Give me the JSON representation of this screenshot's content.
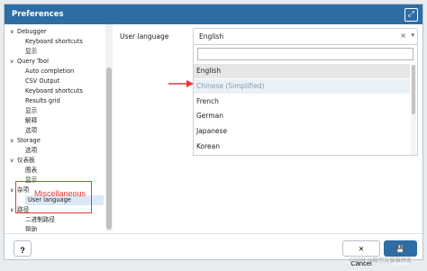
{
  "window": {
    "title": "Preferences"
  },
  "tree": [
    {
      "label": "Debugger",
      "kind": "node",
      "chev": "∨"
    },
    {
      "label": "Keyboard shortcuts",
      "kind": "leaf"
    },
    {
      "label": "显示",
      "kind": "leaf"
    },
    {
      "label": "Query Tool",
      "kind": "node",
      "chev": "∨"
    },
    {
      "label": "Auto completion",
      "kind": "leaf"
    },
    {
      "label": "CSV Output",
      "kind": "leaf"
    },
    {
      "label": "Keyboard shortcuts",
      "kind": "leaf"
    },
    {
      "label": "Results grid",
      "kind": "leaf"
    },
    {
      "label": "显示",
      "kind": "leaf"
    },
    {
      "label": "解释",
      "kind": "leaf"
    },
    {
      "label": "选项",
      "kind": "leaf"
    },
    {
      "label": "Storage",
      "kind": "node",
      "chev": "∨"
    },
    {
      "label": "选项",
      "kind": "leaf"
    },
    {
      "label": "仪表板",
      "kind": "node",
      "chev": "∨"
    },
    {
      "label": "图表",
      "kind": "leaf"
    },
    {
      "label": "显示",
      "kind": "leaf"
    },
    {
      "label": "杂项",
      "kind": "node",
      "chev": "∨"
    },
    {
      "label": "User language",
      "kind": "leaf",
      "selected": true
    },
    {
      "label": "路径",
      "kind": "node",
      "chev": "∨"
    },
    {
      "label": "二进制路径",
      "kind": "leaf"
    },
    {
      "label": "帮助",
      "kind": "leaf"
    }
  ],
  "annotation": {
    "text": "Miscellaneous",
    "color": "#e53935"
  },
  "form": {
    "label": "User language",
    "value": "English",
    "clear": "×",
    "caret": "▾",
    "search_placeholder": ""
  },
  "options": [
    {
      "label": "English",
      "state": "hl"
    },
    {
      "label": "Chinese (Simplified)",
      "state": "dim"
    },
    {
      "label": "French",
      "state": ""
    },
    {
      "label": "German",
      "state": ""
    },
    {
      "label": "Japanese",
      "state": ""
    },
    {
      "label": "Korean",
      "state": ""
    }
  ],
  "footer": {
    "help": "?",
    "cancel": "✕ Cancel",
    "save": "💾 Save"
  },
  "watermark": "CSDN @吸尔又猫猫转变",
  "colors": {
    "accent": "#2e6da4",
    "annotation": "#e53935"
  }
}
